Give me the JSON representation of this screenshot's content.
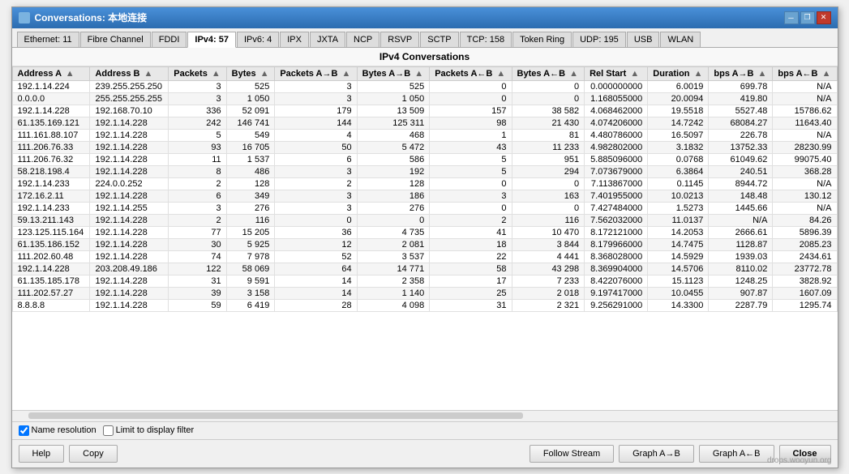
{
  "window": {
    "title": "Conversations: 本地连接",
    "controls": [
      "minimize",
      "restore",
      "close"
    ]
  },
  "tabs": [
    {
      "label": "Ethernet: 11",
      "active": false
    },
    {
      "label": "Fibre Channel",
      "active": false
    },
    {
      "label": "FDDI",
      "active": false
    },
    {
      "label": "IPv4: 57",
      "active": true
    },
    {
      "label": "IPv6: 4",
      "active": false
    },
    {
      "label": "IPX",
      "active": false
    },
    {
      "label": "JXTA",
      "active": false
    },
    {
      "label": "NCP",
      "active": false
    },
    {
      "label": "RSVP",
      "active": false
    },
    {
      "label": "SCTP",
      "active": false
    },
    {
      "label": "TCP: 158",
      "active": false
    },
    {
      "label": "Token Ring",
      "active": false
    },
    {
      "label": "UDP: 195",
      "active": false
    },
    {
      "label": "USB",
      "active": false
    },
    {
      "label": "WLAN",
      "active": false
    }
  ],
  "section_title": "IPv4 Conversations",
  "columns": [
    "Address A",
    "Address B",
    "Packets",
    "Bytes",
    "Packets A→B",
    "Bytes A→B",
    "Packets A←B",
    "Bytes A←B",
    "Rel Start",
    "Duration",
    "bps A→B",
    "bps A←B"
  ],
  "rows": [
    [
      "192.1.14.224",
      "239.255.255.250",
      "3",
      "525",
      "3",
      "525",
      "0",
      "0",
      "0.000000000",
      "6.0019",
      "699.78",
      "N/A"
    ],
    [
      "0.0.0.0",
      "255.255.255.255",
      "3",
      "1 050",
      "3",
      "1 050",
      "0",
      "0",
      "1.168055000",
      "20.0094",
      "419.80",
      "N/A"
    ],
    [
      "192.1.14.228",
      "192.168.70.10",
      "336",
      "52 091",
      "179",
      "13 509",
      "157",
      "38 582",
      "4.068462000",
      "19.5518",
      "5527.48",
      "15786.62"
    ],
    [
      "61.135.169.121",
      "192.1.14.228",
      "242",
      "146 741",
      "144",
      "125 311",
      "98",
      "21 430",
      "4.074206000",
      "14.7242",
      "68084.27",
      "11643.40"
    ],
    [
      "111.161.88.107",
      "192.1.14.228",
      "5",
      "549",
      "4",
      "468",
      "1",
      "81",
      "4.480786000",
      "16.5097",
      "226.78",
      "N/A"
    ],
    [
      "111.206.76.33",
      "192.1.14.228",
      "93",
      "16 705",
      "50",
      "5 472",
      "43",
      "11 233",
      "4.982802000",
      "3.1832",
      "13752.33",
      "28230.99"
    ],
    [
      "111.206.76.32",
      "192.1.14.228",
      "11",
      "1 537",
      "6",
      "586",
      "5",
      "951",
      "5.885096000",
      "0.0768",
      "61049.62",
      "99075.40"
    ],
    [
      "58.218.198.4",
      "192.1.14.228",
      "8",
      "486",
      "3",
      "192",
      "5",
      "294",
      "7.073679000",
      "6.3864",
      "240.51",
      "368.28"
    ],
    [
      "192.1.14.233",
      "224.0.0.252",
      "2",
      "128",
      "2",
      "128",
      "0",
      "0",
      "7.113867000",
      "0.1145",
      "8944.72",
      "N/A"
    ],
    [
      "172.16.2.11",
      "192.1.14.228",
      "6",
      "349",
      "3",
      "186",
      "3",
      "163",
      "7.401955000",
      "10.0213",
      "148.48",
      "130.12"
    ],
    [
      "192.1.14.233",
      "192.1.14.255",
      "3",
      "276",
      "3",
      "276",
      "0",
      "0",
      "7.427484000",
      "1.5273",
      "1445.66",
      "N/A"
    ],
    [
      "59.13.211.143",
      "192.1.14.228",
      "2",
      "116",
      "0",
      "0",
      "2",
      "116",
      "7.562032000",
      "11.0137",
      "N/A",
      "84.26"
    ],
    [
      "123.125.115.164",
      "192.1.14.228",
      "77",
      "15 205",
      "36",
      "4 735",
      "41",
      "10 470",
      "8.172121000",
      "14.2053",
      "2666.61",
      "5896.39"
    ],
    [
      "61.135.186.152",
      "192.1.14.228",
      "30",
      "5 925",
      "12",
      "2 081",
      "18",
      "3 844",
      "8.179966000",
      "14.7475",
      "1128.87",
      "2085.23"
    ],
    [
      "111.202.60.48",
      "192.1.14.228",
      "74",
      "7 978",
      "52",
      "3 537",
      "22",
      "4 441",
      "8.368028000",
      "14.5929",
      "1939.03",
      "2434.61"
    ],
    [
      "192.1.14.228",
      "203.208.49.186",
      "122",
      "58 069",
      "64",
      "14 771",
      "58",
      "43 298",
      "8.369904000",
      "14.5706",
      "8110.02",
      "23772.78"
    ],
    [
      "61.135.185.178",
      "192.1.14.228",
      "31",
      "9 591",
      "14",
      "2 358",
      "17",
      "7 233",
      "8.422076000",
      "15.1123",
      "1248.25",
      "3828.92"
    ],
    [
      "111.202.57.27",
      "192.1.14.228",
      "39",
      "3 158",
      "14",
      "1 140",
      "25",
      "2 018",
      "9.197417000",
      "10.0455",
      "907.87",
      "1607.09"
    ],
    [
      "8.8.8.8",
      "192.1.14.228",
      "59",
      "6 419",
      "28",
      "4 098",
      "31",
      "2 321",
      "9.256291000",
      "14.3300",
      "2287.79",
      "1295.74"
    ]
  ],
  "bottom": {
    "checkbox1_label": "Name resolution",
    "checkbox2_label": "Limit to display filter",
    "checkbox1_checked": true,
    "checkbox2_checked": false
  },
  "buttons": {
    "help": "Help",
    "copy": "Copy",
    "follow_stream": "Follow Stream",
    "graph_ab": "Graph A→B",
    "graph_ba": "Graph A←B",
    "close": "Close"
  },
  "watermark": "drops.wooyun.org"
}
